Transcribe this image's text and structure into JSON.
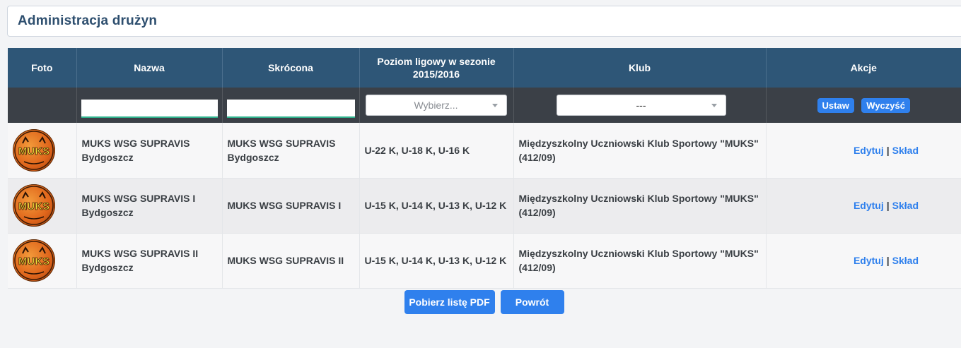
{
  "page": {
    "title": "Administracja drużyn"
  },
  "table": {
    "headers": {
      "photo": "Foto",
      "name": "Nazwa",
      "short": "Skrócona",
      "level_line1": "Poziom ligowy w sezonie",
      "level_line2": "2015/2016",
      "club": "Klub",
      "actions": "Akcje"
    },
    "filters": {
      "name_value": "",
      "short_value": "",
      "level_placeholder": "Wybierz...",
      "club_selected": "---",
      "set_label": "Ustaw",
      "clear_label": "Wyczyść"
    },
    "rows": [
      {
        "logo_text": "MUKS",
        "name_line1": "MUKS WSG SUPRAVIS",
        "name_line2": "Bydgoszcz",
        "short_line1": "MUKS WSG SUPRAVIS",
        "short_line2": "Bydgoszcz",
        "level": "U-22 K, U-18 K, U-16 K",
        "club_line1": "Międzyszkolny Uczniowski Klub Sportowy \"MUKS\"",
        "club_line2": "(412/09)",
        "edit": "Edytuj",
        "squad": "Skład"
      },
      {
        "logo_text": "MUKS",
        "name_line1": "MUKS WSG SUPRAVIS I",
        "name_line2": "Bydgoszcz",
        "short_line1": "MUKS WSG SUPRAVIS I",
        "short_line2": "",
        "level": "U-15 K, U-14 K, U-13 K, U-12 K",
        "club_line1": "Międzyszkolny Uczniowski Klub Sportowy \"MUKS\"",
        "club_line2": "(412/09)",
        "edit": "Edytuj",
        "squad": "Skład"
      },
      {
        "logo_text": "MUKS",
        "name_line1": "MUKS WSG SUPRAVIS II",
        "name_line2": "Bydgoszcz",
        "short_line1": "MUKS WSG SUPRAVIS II",
        "short_line2": "",
        "level": "U-15 K, U-14 K, U-13 K, U-12 K",
        "club_line1": "Międzyszkolny Uczniowski Klub Sportowy \"MUKS\"",
        "club_line2": "(412/09)",
        "edit": "Edytuj",
        "squad": "Skład"
      }
    ],
    "separator": "|"
  },
  "footer": {
    "pdf_button": "Pobierz listę PDF",
    "back_button": "Powrót"
  },
  "colors": {
    "header_bg": "#2e5677",
    "filter_bg": "#3b4047",
    "accent": "#2f80ed",
    "title_text": "#2d4e6e",
    "logo_orange": "#e0651b"
  },
  "icons": {
    "logo": "muks-club-logo",
    "select_arrow": "chevron-down-icon"
  }
}
